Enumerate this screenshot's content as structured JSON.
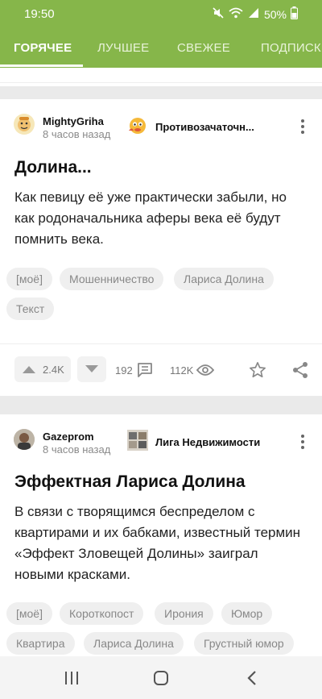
{
  "status": {
    "time": "19:50",
    "battery": "50%"
  },
  "tabs": [
    {
      "label": "ГОРЯЧЕЕ",
      "active": true
    },
    {
      "label": "ЛУЧШЕЕ",
      "active": false
    },
    {
      "label": "СВЕЖЕЕ",
      "active": false
    },
    {
      "label": "ПОДПИСКИ",
      "active": false
    }
  ],
  "posts": [
    {
      "author": "MightyGriha",
      "time_ago": "8 часов назад",
      "community": "Противозачаточн...",
      "title": "Долина...",
      "text": "Как певицу её уже практически забыли, но как родоначальника аферы века её будут помнить века.",
      "tags": [
        "[моё]",
        "Мошенничество",
        "Лариса Долина",
        "Текст"
      ],
      "rating": "2.4K",
      "comments": "192",
      "views": "112K"
    },
    {
      "author": "Gazeprom",
      "time_ago": "8 часов назад",
      "community": "Лига Недвижимости",
      "title": "Эффектная Лариса Долина",
      "text": "В связи с творящимся беспределом с квартирами и их бабками, известный термин «Эффект Зловещей Долины» заиграл новыми красками.",
      "tags": [
        "[моё]",
        "Короткопост",
        "Ирония",
        "Юмор",
        "Квартира",
        "Лариса Долина",
        "Грустный юмор"
      ]
    }
  ],
  "icons": {
    "mute": "mute-icon",
    "wifi": "wifi-icon",
    "signal": "signal-icon",
    "battery": "battery-icon",
    "upvote": "upvote-icon",
    "downvote": "downvote-icon",
    "comments": "comment-icon",
    "views": "eye-icon",
    "save": "star-icon",
    "share": "share-icon",
    "more": "kebab-icon",
    "nav_recent": "recent-apps-icon",
    "nav_home": "home-icon",
    "nav_back": "back-icon"
  },
  "colors": {
    "brand": "#86b64a",
    "background": "#eaeaea",
    "tag_bg": "#efefef",
    "muted_text": "#8a8a8a"
  }
}
